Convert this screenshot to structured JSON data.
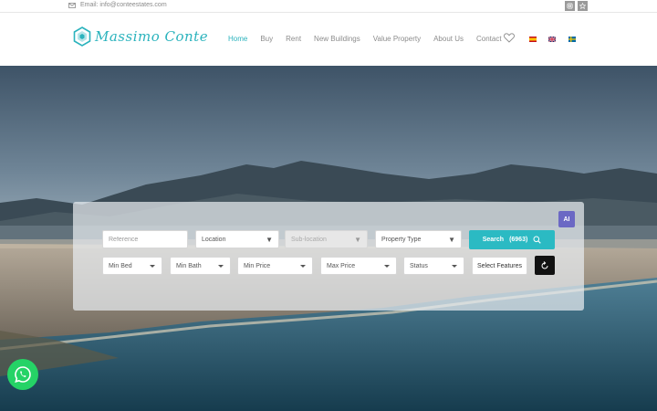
{
  "topbar": {
    "email_label": "Email: info@conteestates.com"
  },
  "logo": {
    "text": "Massimo Conte"
  },
  "nav": {
    "items": [
      {
        "label": "Home",
        "active": true
      },
      {
        "label": "Buy",
        "active": false
      },
      {
        "label": "Rent",
        "active": false
      },
      {
        "label": "New Buildings",
        "active": false
      },
      {
        "label": "Value Property",
        "active": false
      },
      {
        "label": "About Us",
        "active": false
      },
      {
        "label": "Contact",
        "active": false
      }
    ]
  },
  "search": {
    "reference_placeholder": "Reference",
    "location": "Location",
    "sublocation": "Sub-location",
    "property_type": "Property Type",
    "search_label": "Search",
    "search_count": "(6963)",
    "min_bed": "Min Bed",
    "min_bath": "Min Bath",
    "min_price": "Min Price",
    "max_price": "Max Price",
    "status": "Status",
    "features": "Select Features",
    "ai_badge": "AI"
  },
  "colors": {
    "accent": "#2bb3bd",
    "ai": "#6b68c4",
    "whatsapp": "#25d366"
  },
  "icons": [
    "mail-icon",
    "instagram-icon",
    "star-icon",
    "heart-icon",
    "flag-es-icon",
    "flag-en-icon",
    "flag-se-icon",
    "search-icon",
    "reset-icon",
    "whatsapp-icon"
  ]
}
